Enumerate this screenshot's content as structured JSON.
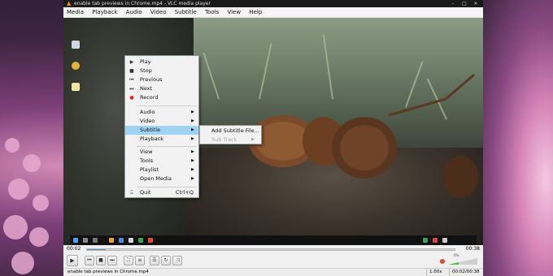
{
  "window": {
    "title": "enable tab previews in Chrome.mp4 - VLC media player",
    "controls": [
      "–",
      "□",
      "✕"
    ]
  },
  "menubar": [
    "Media",
    "Playback",
    "Audio",
    "Video",
    "Subtitle",
    "Tools",
    "View",
    "Help"
  ],
  "context_menu": {
    "items": [
      {
        "icon": "play-icon",
        "glyph": "▶",
        "label": "Play"
      },
      {
        "icon": "stop-icon",
        "glyph": "■",
        "label": "Stop"
      },
      {
        "icon": "previous-icon",
        "glyph": "⏮",
        "label": "Previous"
      },
      {
        "icon": "next-icon",
        "glyph": "⏭",
        "label": "Next"
      },
      {
        "icon": "record-icon",
        "glyph": "●",
        "label": "Record"
      },
      {
        "label": "Audio"
      },
      {
        "label": "Video"
      },
      {
        "label": "Subtitle"
      },
      {
        "label": "Playback"
      },
      {
        "label": "View"
      },
      {
        "label": "Tools"
      },
      {
        "label": "Playlist"
      },
      {
        "label": "Open Media"
      },
      {
        "icon": "quit-icon",
        "glyph": "⍈",
        "label": "Quit",
        "shortcut": "Ctrl+Q"
      }
    ]
  },
  "submenu": {
    "items": [
      {
        "label": "Add Subtitle File...",
        "enabled": true
      },
      {
        "label": "Sub Track",
        "enabled": false
      }
    ]
  },
  "playback": {
    "elapsed": "00:02",
    "total": "00:38",
    "progress": 0.05
  },
  "volume": {
    "percent_label": "0%",
    "level": 0.36
  },
  "statusbar": {
    "filename": "enable tab previews in Chrome.mp4",
    "speed": "1.00x",
    "time": "00:02/00:38"
  },
  "colors": {
    "accent": "#9fd3f3",
    "seek": "#5b8fd0",
    "record": "#e0201b",
    "vlc_cone": "#ff8800",
    "volume": "#57b94c"
  }
}
